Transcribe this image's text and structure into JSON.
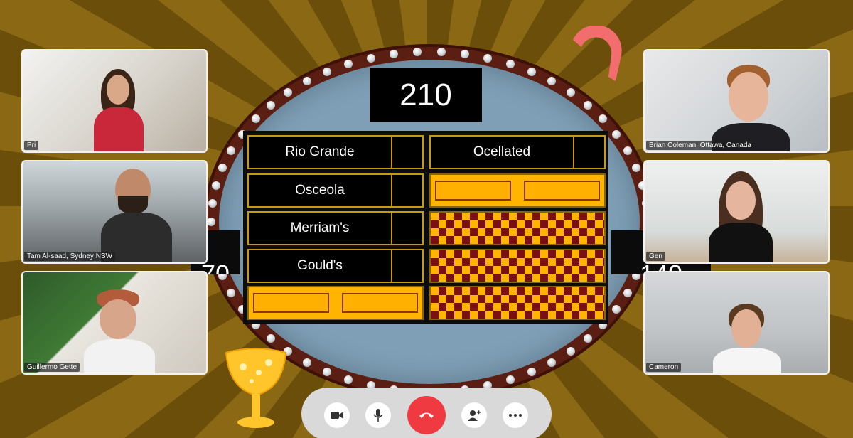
{
  "game": {
    "round_score": "210",
    "left_team_score": "70",
    "right_team_score": "140",
    "answers_left": [
      {
        "text": "Rio Grande",
        "state": "revealed"
      },
      {
        "text": "Osceola",
        "state": "revealed"
      },
      {
        "text": "Merriam's",
        "state": "revealed"
      },
      {
        "text": "Gould's",
        "state": "revealed"
      },
      {
        "text": "",
        "state": "hidden"
      }
    ],
    "answers_right": [
      {
        "text": "Ocellated",
        "state": "revealed"
      },
      {
        "text": "",
        "state": "hidden"
      },
      {
        "text": "",
        "state": "empty"
      },
      {
        "text": "",
        "state": "empty"
      },
      {
        "text": "",
        "state": "empty"
      }
    ]
  },
  "participants": {
    "left": [
      {
        "name": "Pri"
      },
      {
        "name": "Tam Al-saad, Sydney NSW"
      },
      {
        "name": "Guillermo Gette"
      }
    ],
    "right": [
      {
        "name": "Brian Coleman, Ottawa, Canada"
      },
      {
        "name": "Gen"
      },
      {
        "name": "Cameron"
      }
    ]
  },
  "toolbar": {
    "buttons": [
      {
        "icon": "video-camera-icon"
      },
      {
        "icon": "microphone-icon"
      },
      {
        "icon": "end-call-icon",
        "color": "#f03a42"
      },
      {
        "icon": "add-person-icon"
      },
      {
        "icon": "more-options-icon"
      }
    ]
  },
  "colors": {
    "board_gold": "#ffb400",
    "checker_red": "#7a0f14",
    "frame_maroon": "#5b1e12",
    "stage_blue": "#7e9fb6",
    "reaction_pink": "#f26d6d"
  }
}
